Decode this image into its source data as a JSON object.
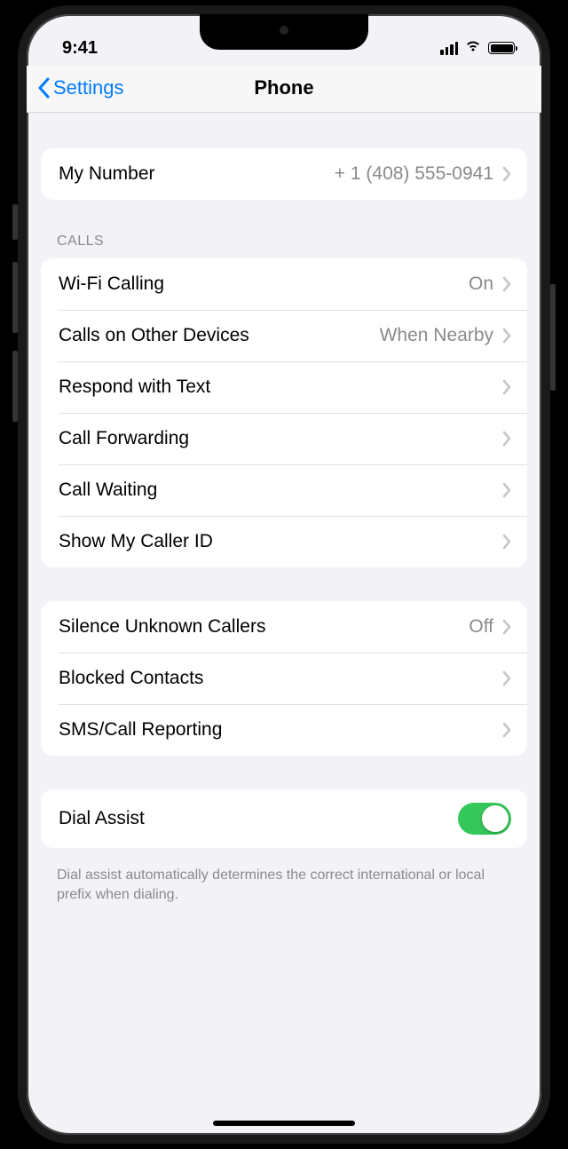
{
  "status": {
    "time": "9:41"
  },
  "nav": {
    "back": "Settings",
    "title": "Phone"
  },
  "groups": {
    "myNumber": {
      "label": "My Number",
      "value": "+ 1 (408) 555-0941"
    },
    "callsHeader": "CALLS",
    "calls": [
      {
        "label": "Wi-Fi Calling",
        "value": "On"
      },
      {
        "label": "Calls on Other Devices",
        "value": "When Nearby"
      },
      {
        "label": "Respond with Text",
        "value": ""
      },
      {
        "label": "Call Forwarding",
        "value": ""
      },
      {
        "label": "Call Waiting",
        "value": ""
      },
      {
        "label": "Show My Caller ID",
        "value": ""
      }
    ],
    "blocking": [
      {
        "label": "Silence Unknown Callers",
        "value": "Off"
      },
      {
        "label": "Blocked Contacts",
        "value": ""
      },
      {
        "label": "SMS/Call Reporting",
        "value": ""
      }
    ],
    "dialAssist": {
      "label": "Dial Assist",
      "enabled": true,
      "footer": "Dial assist automatically determines the correct international or local prefix when dialing."
    }
  }
}
